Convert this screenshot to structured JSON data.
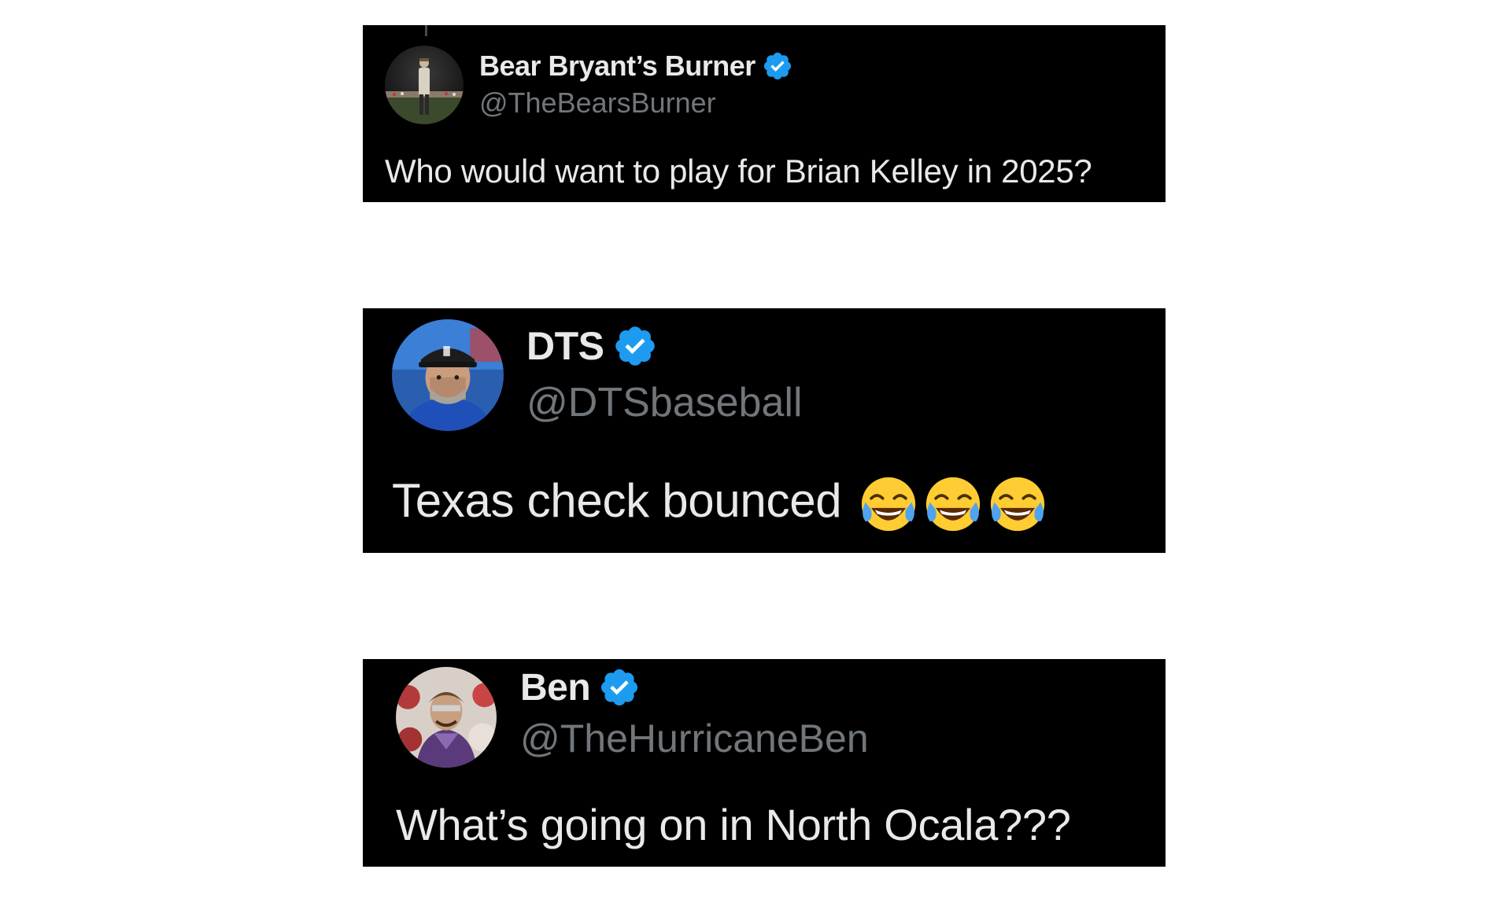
{
  "colors": {
    "card_background": "#000000",
    "name_text": "#e7e9ea",
    "handle_text": "#71767b",
    "verified_badge": "#1d9bf0",
    "page_background": "#ffffff"
  },
  "tweets": [
    {
      "display_name": "Bear Bryant’s Burner",
      "handle": "@TheBearsBurner",
      "verified": true,
      "verified_icon": "verified-badge-icon",
      "avatar_icon": "profile-photo-stadium-figure",
      "text": "Who would want to play for Brian Kelley in 2025?",
      "emojis": []
    },
    {
      "display_name": "DTS",
      "handle": "@DTSbaseball",
      "verified": true,
      "verified_icon": "verified-badge-icon",
      "avatar_icon": "profile-photo-man-in-cap",
      "text": "Texas check bounced",
      "emojis": [
        "face-with-tears-of-joy",
        "face-with-tears-of-joy",
        "face-with-tears-of-joy"
      ]
    },
    {
      "display_name": "Ben",
      "handle": "@TheHurricaneBen",
      "verified": true,
      "verified_icon": "verified-badge-icon",
      "avatar_icon": "profile-photo-crowd-celebration",
      "text": "What’s going on in North Ocala???",
      "emojis": []
    }
  ]
}
